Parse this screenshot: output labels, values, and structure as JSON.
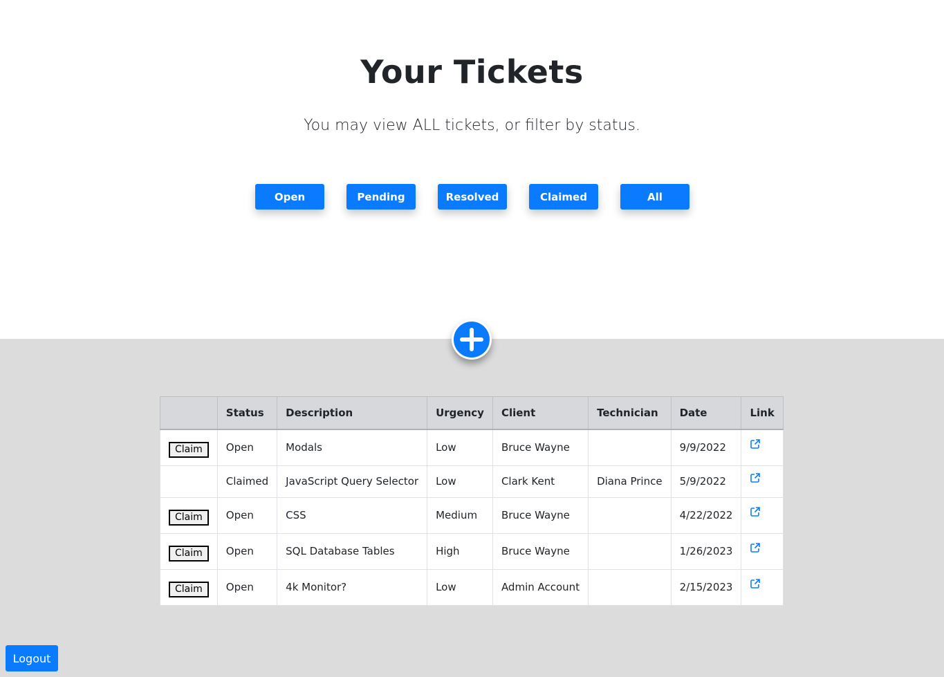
{
  "header": {
    "title": "Your Tickets",
    "subtitle": "You may view ALL tickets, or filter by status."
  },
  "filters": [
    {
      "label": "Open"
    },
    {
      "label": "Pending"
    },
    {
      "label": "Resolved"
    },
    {
      "label": "Claimed"
    },
    {
      "label": "All"
    }
  ],
  "add_button": {
    "icon": "plus-circle-icon"
  },
  "table": {
    "columns": [
      "",
      "Status",
      "Description",
      "Urgency",
      "Client",
      "Technician",
      "Date",
      "Link"
    ],
    "rows": [
      {
        "action": "Claim",
        "status": "Open",
        "description": "Modals",
        "urgency": "Low",
        "client": "Bruce Wayne",
        "technician": "",
        "date": "9/9/2022"
      },
      {
        "action": "",
        "status": "Claimed",
        "description": "JavaScript Query Selector",
        "urgency": "Low",
        "client": "Clark Kent",
        "technician": "Diana Prince",
        "date": "5/9/2022"
      },
      {
        "action": "Claim",
        "status": "Open",
        "description": "CSS",
        "urgency": "Medium",
        "client": "Bruce Wayne",
        "technician": "",
        "date": "4/22/2022"
      },
      {
        "action": "Claim",
        "status": "Open",
        "description": "SQL Database Tables",
        "urgency": "High",
        "client": "Bruce Wayne",
        "technician": "",
        "date": "1/26/2023"
      },
      {
        "action": "Claim",
        "status": "Open",
        "description": "4k Monitor?",
        "urgency": "Low",
        "client": "Admin Account",
        "technician": "",
        "date": "2/15/2023"
      }
    ],
    "link_icon": "external-link-icon"
  },
  "logout": {
    "label": "Logout"
  },
  "colors": {
    "primary": "#0a7bff",
    "lower_background": "#dcdcdd",
    "table_header": "#d6d8dc"
  }
}
